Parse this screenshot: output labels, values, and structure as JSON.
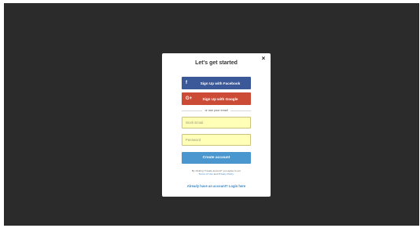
{
  "modal": {
    "close_glyph": "×",
    "title": "Let's get started",
    "facebook_button": {
      "icon": "facebook-icon",
      "glyph": "f",
      "label": "Sign Up with Facebook",
      "color": "#3b5998"
    },
    "google_button": {
      "icon": "google-plus-icon",
      "glyph": "G+",
      "label": "Sign Up with Google",
      "color": "#cc4b37"
    },
    "divider_text": "or use your email",
    "email_field": {
      "placeholder": "Work Email",
      "value": ""
    },
    "password_field": {
      "placeholder": "Password",
      "value": ""
    },
    "create_button": {
      "label": "Create account",
      "color": "#4a96cf"
    },
    "terms": {
      "prefix": "By clicking \"Create account\" you agree to our",
      "terms_link": "Terms of Use",
      "and": " and ",
      "privacy_link": "Privacy Policy",
      "suffix": "."
    },
    "login_link": "Already have an account? Login here"
  },
  "colors": {
    "backdrop": "#2b2b2b",
    "input_fill": "#ffffb8",
    "link": "#3f87c4"
  }
}
